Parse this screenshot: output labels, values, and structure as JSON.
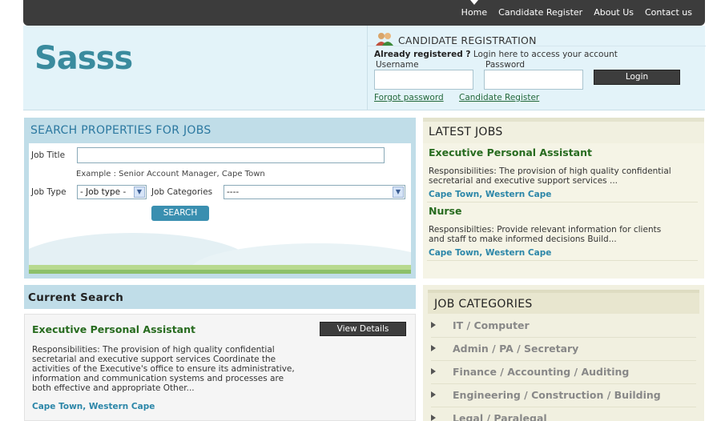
{
  "nav": {
    "items": [
      "Home",
      "Candidate Register",
      "About Us",
      "Contact us"
    ],
    "active": "Home"
  },
  "logo": "Sasss",
  "registration": {
    "title": "CANDIDATE REGISTRATION",
    "already_bold": "Already registered ?",
    "already_text": " Login here to access your account",
    "username_label": "Username",
    "password_label": "Password",
    "username_value": "",
    "password_value": "",
    "login_button": "Login",
    "forgot_link": "Forgot password",
    "register_link": "Candidate Register",
    "icon": "users-icon"
  },
  "search": {
    "title": "SEARCH PROPERTIES FOR JOBS",
    "job_title_label": "Job Title",
    "job_title_value": "",
    "example": "Example : Senior Account Manager, Cape Town",
    "job_type_label": "Job Type",
    "job_type_value": "- Job type -",
    "job_categories_label": "Job Categories",
    "job_categories_value": "----",
    "search_button": "SEARCH"
  },
  "latest": {
    "title": "LATEST JOBS",
    "jobs": [
      {
        "title": "Executive Personal Assistant",
        "desc1": "Responsibilities: The provision of high quality confidential",
        "desc2": "secretarial and executive support services  ...",
        "location": "Cape Town, Western Cape"
      },
      {
        "title": "Nurse",
        "desc1": "Responsibilties: Provide relevant information for clients",
        "desc2": "and staff to make informed decisions Build...",
        "location": "Cape Town, Western Cape"
      }
    ]
  },
  "current": {
    "title": "Current Search",
    "job_title": "Executive Personal Assistant",
    "view_button": "View Details",
    "desc_lines": [
      "Responsibilities: The provision of high quality confidential",
      "secretarial and executive support services   Coordinate the",
      "activities of the Executive's office to ensure its administrative,",
      "information and communication systems and processes are",
      "both effective and appropriate Other..."
    ],
    "location": "Cape Town, Western Cape"
  },
  "categories": {
    "title": "JOB CATEGORIES",
    "items": [
      "IT / Computer",
      "Admin / PA / Secretary",
      "Finance / Accounting / Auditing",
      "Engineering / Construction / Building",
      "Legal / Paralegal"
    ]
  },
  "colors": {
    "accent": "#3a8b9e",
    "link_green": "#276b1f",
    "location_blue": "#2b86a8",
    "nav_bg": "#3c3c3c"
  }
}
